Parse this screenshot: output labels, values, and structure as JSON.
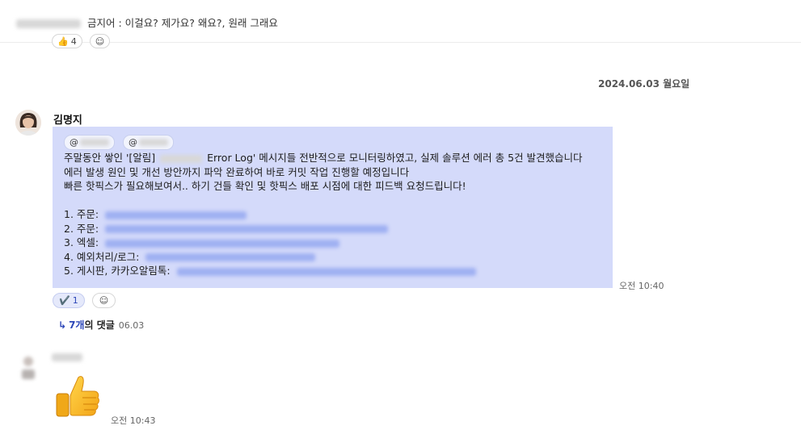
{
  "previous_message": {
    "text": "금지어 : 이걸요? 제가요? 왜요?, 원래 그래요",
    "reactions": [
      {
        "icon": "thumbs-up",
        "emoji": "👍",
        "count": "4"
      },
      {
        "icon": "add-reaction",
        "emoji": "☺",
        "count": ""
      }
    ]
  },
  "date_divider": "2024.06.03 월요일",
  "message": {
    "sender": "김명지",
    "mention_prefix": "@",
    "body_lines": [
      {
        "before": "주말동안 쌓인 '[알림]",
        "after": "Error Log' 메시지들 전반적으로 모니터링하였고, 실제 솔루션 에러 총 5건 발견했습니다"
      },
      {
        "text": "에러 발생 원인 및 개선 방안까지 파악 완료하여 바로 커밋 작업 진행할 예정입니다"
      },
      {
        "text": "빠른 핫픽스가 필요해보여서.. 하기 건들 확인 및 핫픽스 배포 시점에 대한 피드백 요청드립니다!"
      }
    ],
    "list_items": [
      "1. 주문:",
      "2. 주문:",
      "3. 엑셀:",
      "4. 예외처리/로그:",
      "5. 게시판, 카카오알림톡:"
    ],
    "time": "오전 10:40",
    "reactions": [
      {
        "icon": "check-mark",
        "emoji": "✔️",
        "count": "1"
      },
      {
        "icon": "add-reaction",
        "emoji": "☺",
        "count": ""
      }
    ],
    "thread": {
      "arrow": "↳",
      "count": "7개",
      "suffix": "의 댓글",
      "date": "06.03"
    }
  },
  "reply": {
    "emoji_icon": "thumbs-up",
    "time": "오전 10:43"
  },
  "colors": {
    "bubble": "#d4dafa",
    "accent": "#2d47b8",
    "mention_bg": "#f2f4fd"
  }
}
